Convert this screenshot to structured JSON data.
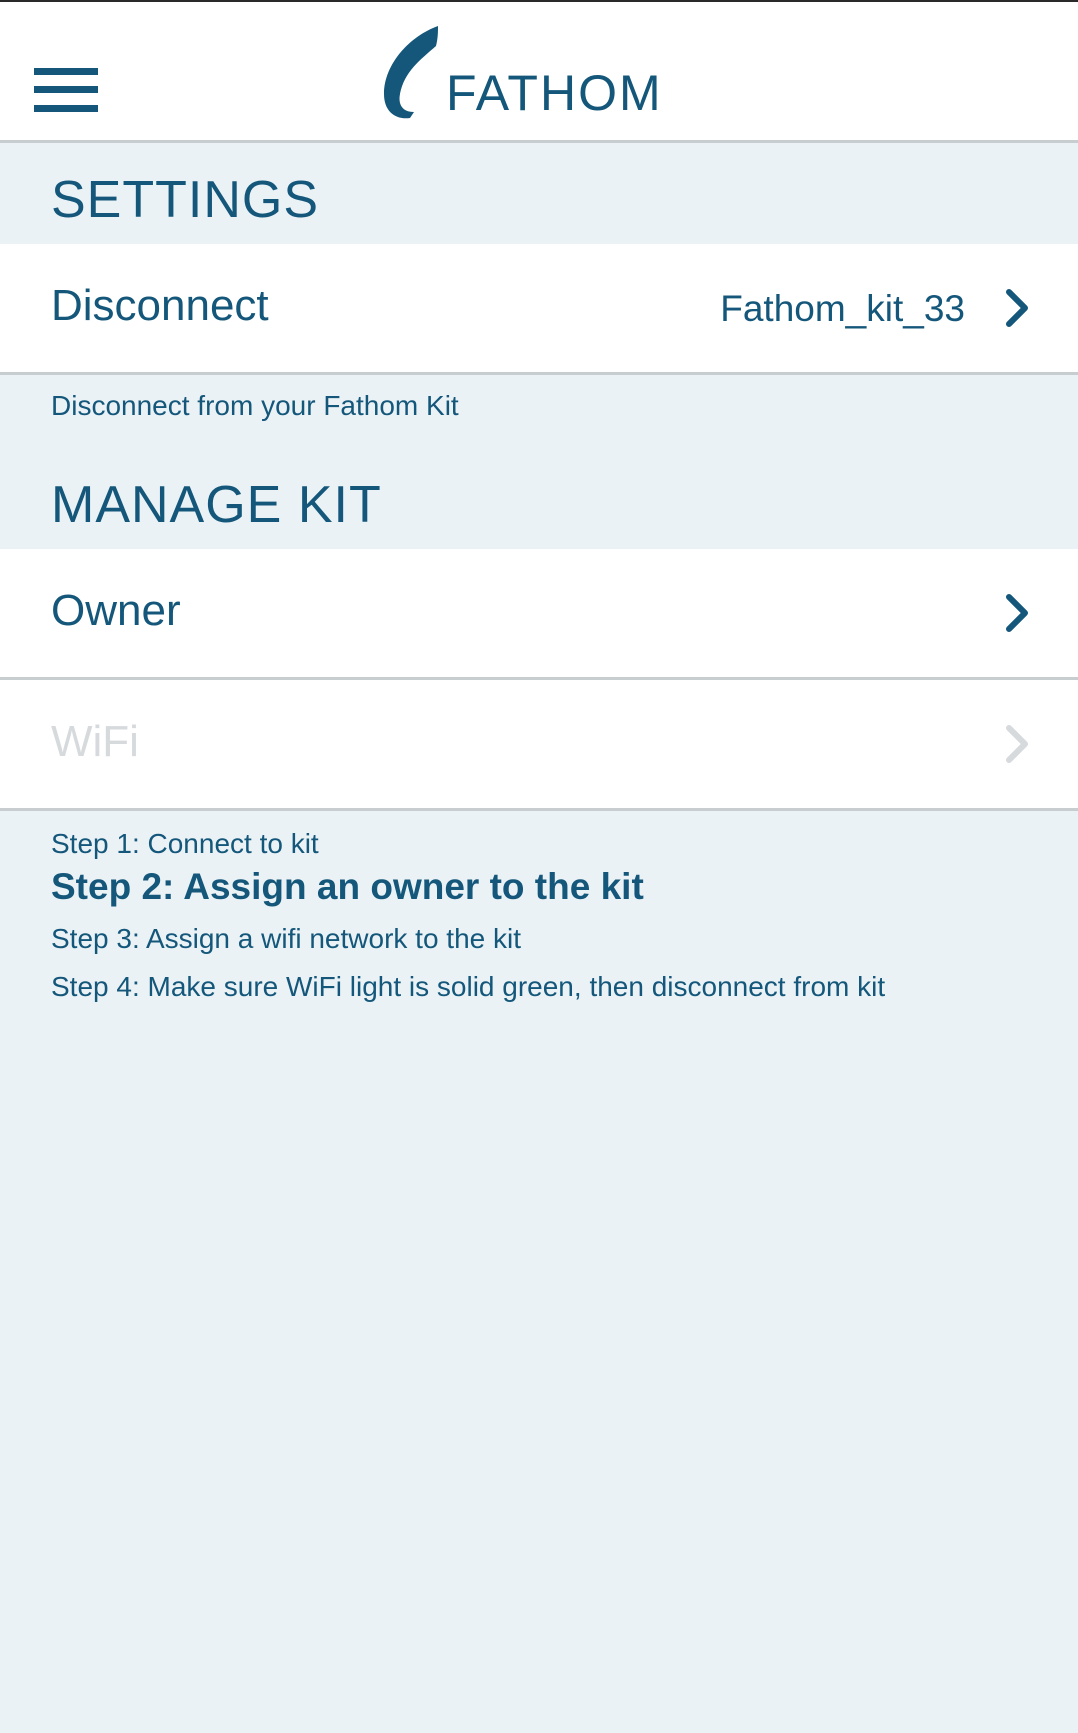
{
  "header": {
    "logo_text": "FATHOM",
    "icons": {
      "menu": "hamburger-menu-icon",
      "logo": "fathom-feather-logo"
    }
  },
  "settings": {
    "title": "SETTINGS",
    "disconnect": {
      "label": "Disconnect",
      "value": "Fathom_kit_33"
    },
    "description": "Disconnect from your Fathom Kit"
  },
  "manage_kit": {
    "title": "MANAGE KIT",
    "owner": {
      "label": "Owner"
    },
    "wifi": {
      "label": "WiFi",
      "disabled": true
    }
  },
  "steps": [
    "Step 1: Connect to kit",
    "Step 2: Assign an owner to the kit",
    "Step 3: Assign a wifi network to the kit",
    "Step 4: Make sure WiFi light is solid green, then disconnect from kit"
  ],
  "colors": {
    "primary": "#14577a",
    "background": "#eaf2f6",
    "row_background": "#ffffff",
    "divider": "#c8cdd0",
    "disabled": "#d7dadc"
  }
}
